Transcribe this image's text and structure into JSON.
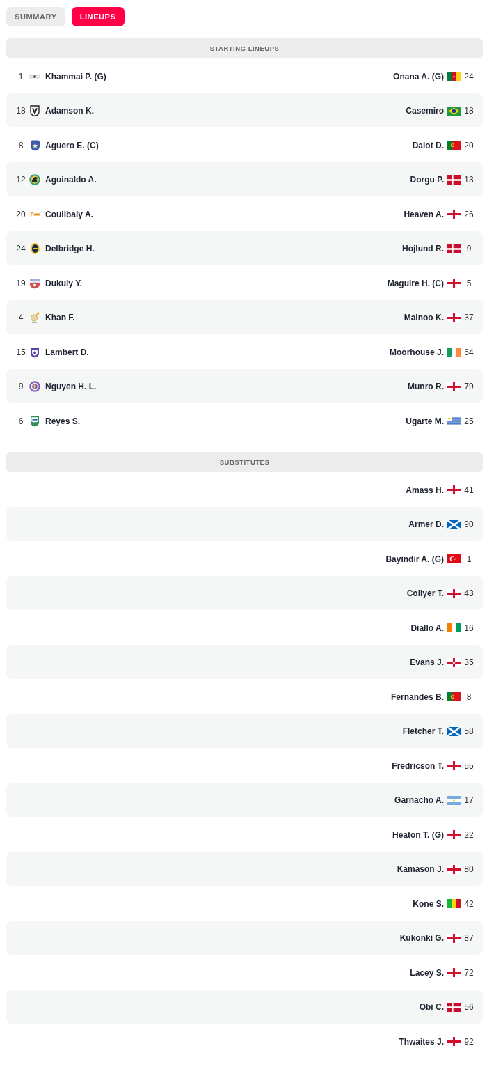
{
  "tabs": [
    {
      "label": "SUMMARY",
      "selected": false
    },
    {
      "label": "LINEUPS",
      "selected": true
    }
  ],
  "starting_lineups": {
    "title": "STARTING LINEUPS",
    "rows": [
      {
        "home": {
          "number": "1",
          "crest": {
            "kind": "pennant"
          },
          "name": "Khammai P. (G)"
        },
        "away": {
          "name": "Onana A. (G)",
          "flag": {
            "kind": "cameroon"
          },
          "number": "24"
        }
      },
      {
        "home": {
          "number": "18",
          "crest": {
            "kind": "v-shield"
          },
          "name": "Adamson K."
        },
        "away": {
          "name": "Casemiro",
          "flag": {
            "kind": "brazil"
          },
          "number": "18"
        }
      },
      {
        "home": {
          "number": "8",
          "crest": {
            "kind": "star-badge"
          },
          "name": "Aguero E. (C)"
        },
        "away": {
          "name": "Dalot D.",
          "flag": {
            "kind": "portugal"
          },
          "number": "20"
        }
      },
      {
        "home": {
          "number": "12",
          "crest": {
            "kind": "horse-round"
          },
          "name": "Aguinaldo A."
        },
        "away": {
          "name": "Dorgu P.",
          "flag": {
            "kind": "denmark"
          },
          "number": "13"
        }
      },
      {
        "home": {
          "number": "20",
          "crest": {
            "kind": "wordmark"
          },
          "name": "Coulibaly A."
        },
        "away": {
          "name": "Heaven A.",
          "flag": {
            "kind": "england"
          },
          "number": "26"
        }
      },
      {
        "home": {
          "number": "24",
          "crest": {
            "kind": "oval"
          },
          "name": "Delbridge H."
        },
        "away": {
          "name": "Hojlund R.",
          "flag": {
            "kind": "denmark"
          },
          "number": "9"
        }
      },
      {
        "home": {
          "number": "19",
          "crest": {
            "kind": "ball-shield"
          },
          "name": "Dukuly Y."
        },
        "away": {
          "name": "Maguire H. (C)",
          "flag": {
            "kind": "england"
          },
          "number": "5"
        }
      },
      {
        "home": {
          "number": "4",
          "crest": {
            "kind": "swoosh"
          },
          "name": "Khan F."
        },
        "away": {
          "name": "Mainoo K.",
          "flag": {
            "kind": "england"
          },
          "number": "37"
        }
      },
      {
        "home": {
          "number": "15",
          "crest": {
            "kind": "lion-shield"
          },
          "name": "Lambert D."
        },
        "away": {
          "name": "Moorhouse J.",
          "flag": {
            "kind": "ireland"
          },
          "number": "64"
        }
      },
      {
        "home": {
          "number": "9",
          "crest": {
            "kind": "tower-round"
          },
          "name": "Nguyen H. L."
        },
        "away": {
          "name": "Munro R.",
          "flag": {
            "kind": "england"
          },
          "number": "79"
        }
      },
      {
        "home": {
          "number": "6",
          "crest": {
            "kind": "fcc-shield"
          },
          "name": "Reyes S."
        },
        "away": {
          "name": "Ugarte M.",
          "flag": {
            "kind": "uruguay"
          },
          "number": "25"
        }
      }
    ]
  },
  "substitutes": {
    "title": "SUBSTITUTES",
    "rows": [
      {
        "away": {
          "name": "Amass H.",
          "flag": {
            "kind": "england"
          },
          "number": "41"
        }
      },
      {
        "away": {
          "name": "Armer D.",
          "flag": {
            "kind": "scotland"
          },
          "number": "90"
        }
      },
      {
        "away": {
          "name": "Bayindir A. (G)",
          "flag": {
            "kind": "turkey"
          },
          "number": "1"
        }
      },
      {
        "away": {
          "name": "Collyer T.",
          "flag": {
            "kind": "england"
          },
          "number": "43"
        }
      },
      {
        "away": {
          "name": "Diallo A.",
          "flag": {
            "kind": "ivory-coast"
          },
          "number": "16"
        }
      },
      {
        "away": {
          "name": "Evans J.",
          "flag": {
            "kind": "northern-ireland"
          },
          "number": "35"
        }
      },
      {
        "away": {
          "name": "Fernandes B.",
          "flag": {
            "kind": "portugal"
          },
          "number": "8"
        }
      },
      {
        "away": {
          "name": "Fletcher T.",
          "flag": {
            "kind": "scotland"
          },
          "number": "58"
        }
      },
      {
        "away": {
          "name": "Fredricson T.",
          "flag": {
            "kind": "england"
          },
          "number": "55"
        }
      },
      {
        "away": {
          "name": "Garnacho A.",
          "flag": {
            "kind": "argentina"
          },
          "number": "17"
        }
      },
      {
        "away": {
          "name": "Heaton T. (G)",
          "flag": {
            "kind": "england"
          },
          "number": "22"
        }
      },
      {
        "away": {
          "name": "Kamason J.",
          "flag": {
            "kind": "england"
          },
          "number": "80"
        }
      },
      {
        "away": {
          "name": "Kone S.",
          "flag": {
            "kind": "mali"
          },
          "number": "42"
        }
      },
      {
        "away": {
          "name": "Kukonki G.",
          "flag": {
            "kind": "england"
          },
          "number": "87"
        }
      },
      {
        "away": {
          "name": "Lacey S.",
          "flag": {
            "kind": "england"
          },
          "number": "72"
        }
      },
      {
        "away": {
          "name": "Obi C.",
          "flag": {
            "kind": "denmark"
          },
          "number": "56"
        }
      },
      {
        "away": {
          "name": "Thwaites J.",
          "flag": {
            "kind": "england"
          },
          "number": "92"
        }
      }
    ]
  }
}
